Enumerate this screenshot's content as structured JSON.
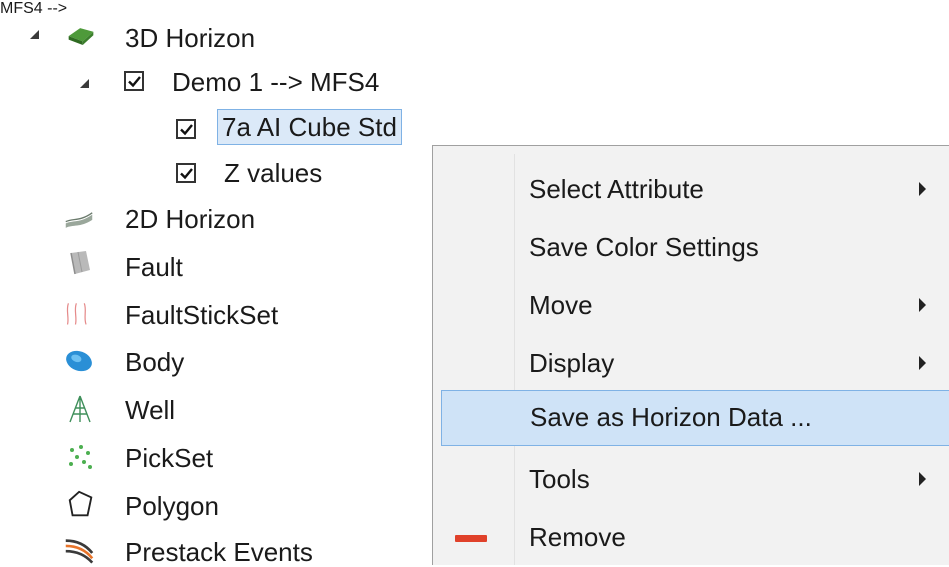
{
  "tree": {
    "items": [
      {
        "label": "3D Horizon",
        "icon": "3d-horizon-icon"
      },
      {
        "label": "Demo 1 --> MFS4",
        "checked": true
      },
      {
        "label": "7a AI Cube Std",
        "checked": true,
        "selected": true
      },
      {
        "label": "Z values",
        "checked": true
      },
      {
        "label": "2D Horizon",
        "icon": "2d-horizon-icon"
      },
      {
        "label": "Fault",
        "icon": "fault-icon"
      },
      {
        "label": "FaultStickSet",
        "icon": "faultstickset-icon"
      },
      {
        "label": "Body",
        "icon": "body-icon"
      },
      {
        "label": "Well",
        "icon": "well-icon"
      },
      {
        "label": "PickSet",
        "icon": "pickset-icon"
      },
      {
        "label": "Polygon",
        "icon": "polygon-icon"
      },
      {
        "label": "Prestack Events",
        "icon": "prestack-events-icon"
      }
    ]
  },
  "context_menu": {
    "items": [
      {
        "label": "Select Attribute",
        "submenu": true
      },
      {
        "label": "Save Color Settings",
        "submenu": false
      },
      {
        "label": "Move",
        "submenu": true
      },
      {
        "label": "Display",
        "submenu": true
      },
      {
        "label": "Save as Horizon Data ...",
        "submenu": false,
        "highlighted": true
      },
      {
        "label": "Tools",
        "submenu": true
      },
      {
        "label": "Remove",
        "submenu": false,
        "icon": "remove-icon"
      }
    ]
  },
  "colors": {
    "selection_bg": "#dbe9f8",
    "selection_border": "#7fb2e5",
    "menu_bg": "#f2f2f2",
    "remove_icon": "#e0412a"
  }
}
